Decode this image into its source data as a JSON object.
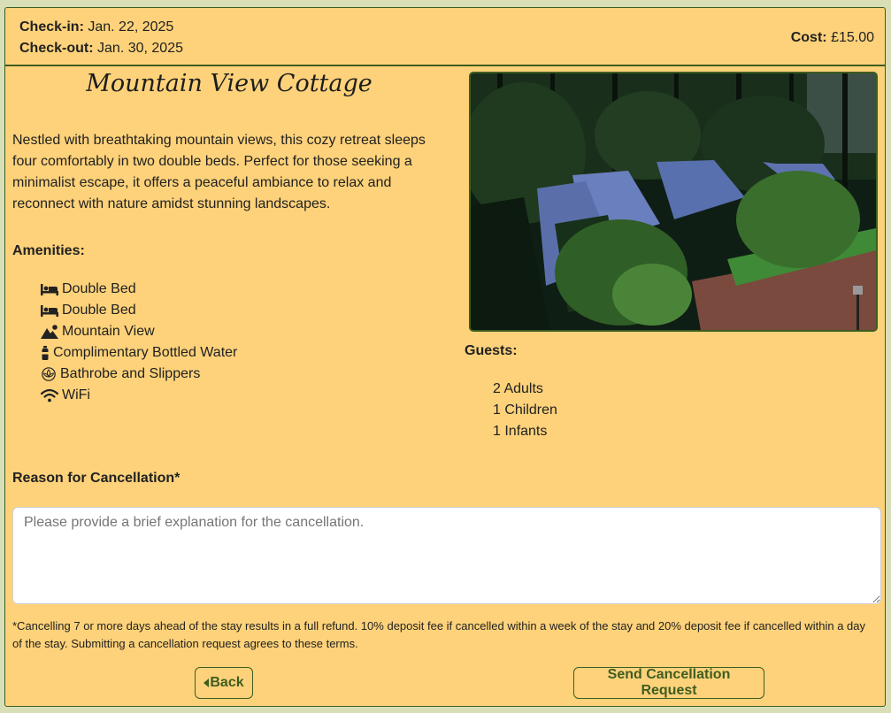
{
  "booking": {
    "checkin_label": "Check-in:",
    "checkin_value": "Jan. 22, 2025",
    "checkout_label": "Check-out:",
    "checkout_value": "Jan. 30, 2025",
    "cost_label": "Cost:",
    "cost_value": "£15.00"
  },
  "property": {
    "title": "Mountain View Cottage",
    "description": "Nestled with breathtaking mountain views, this cozy retreat sleeps four comfortably in two double beds. Perfect for those seeking a minimalist escape, it offers a peaceful ambiance to relax and reconnect with nature amidst stunning landscapes."
  },
  "amenities": {
    "heading": "Amenities:",
    "items": [
      {
        "label": "Double Bed",
        "icon": "bed-icon"
      },
      {
        "label": "Double Bed",
        "icon": "bed-icon"
      },
      {
        "label": "Mountain View",
        "icon": "mountain-sun-icon"
      },
      {
        "label": "Complimentary Bottled Water",
        "icon": "bottle-icon"
      },
      {
        "label": "Bathrobe and Slippers",
        "icon": "spa-icon"
      },
      {
        "label": "WiFi",
        "icon": "wifi-icon"
      }
    ]
  },
  "guests": {
    "heading": "Guests:",
    "adults": "2 Adults",
    "children": "1 Children",
    "infants": "1 Infants"
  },
  "cancellation": {
    "label": "Reason for Cancellation*",
    "placeholder": "Please provide a brief explanation for the cancellation.",
    "value": "",
    "terms": "*Cancelling 7 or more days ahead of the stay results in a full refund. 10% deposit fee if cancelled within a week of the stay and 20% deposit fee if cancelled within a day of the stay. Submitting a cancellation request agrees to these terms."
  },
  "actions": {
    "back_label": "Back",
    "send_label": "Send Cancellation Request"
  },
  "colors": {
    "card_background": "#fed27a",
    "accent_green": "#3e5d20",
    "page_background": "#d8dfb6"
  }
}
